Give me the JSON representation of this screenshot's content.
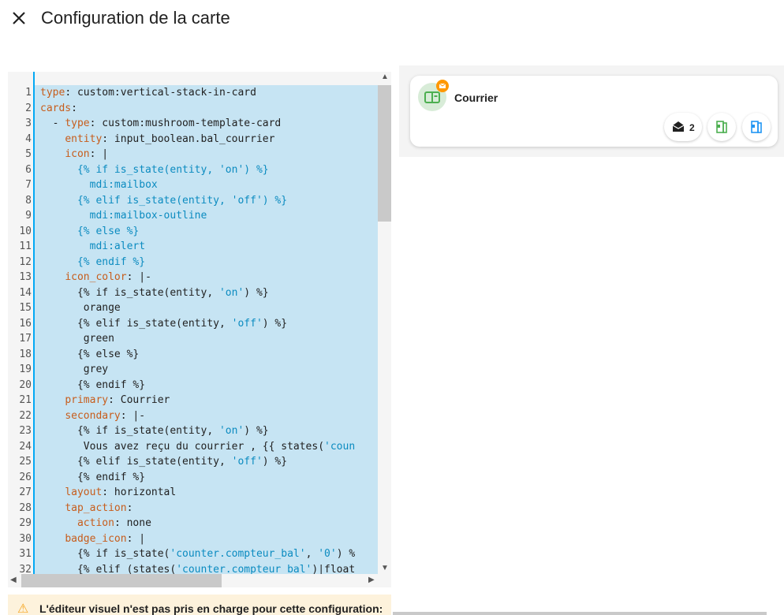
{
  "dialog": {
    "title": "Configuration de la carte"
  },
  "editor": {
    "line_numbers": [
      "1",
      "2",
      "3",
      "4",
      "5",
      "6",
      "7",
      "8",
      "9",
      "10",
      "11",
      "12",
      "13",
      "14",
      "15",
      "16",
      "17",
      "18",
      "19",
      "20",
      "21",
      "22",
      "23",
      "24",
      "25",
      "26",
      "27",
      "28",
      "29",
      "30",
      "31",
      "32"
    ],
    "lines": [
      [
        [
          "k",
          "type"
        ],
        [
          "p",
          ": custom:vertical-stack-in-card"
        ]
      ],
      [
        [
          "k",
          "cards"
        ],
        [
          "p",
          ":"
        ]
      ],
      [
        [
          "p",
          "  - "
        ],
        [
          "k",
          "type"
        ],
        [
          "p",
          ": custom:mushroom-template-card"
        ]
      ],
      [
        [
          "p",
          "    "
        ],
        [
          "k",
          "entity"
        ],
        [
          "p",
          ": input_boolean.bal_courrier"
        ]
      ],
      [
        [
          "p",
          "    "
        ],
        [
          "k",
          "icon"
        ],
        [
          "p",
          ": |"
        ]
      ],
      [
        [
          "p",
          "      "
        ],
        [
          "t",
          "{% if is_state(entity, 'on') %}"
        ]
      ],
      [
        [
          "p",
          "        "
        ],
        [
          "t",
          "mdi:mailbox"
        ]
      ],
      [
        [
          "p",
          "      "
        ],
        [
          "t",
          "{% elif is_state(entity, 'off') %}"
        ]
      ],
      [
        [
          "p",
          "        "
        ],
        [
          "t",
          "mdi:mailbox-outline"
        ]
      ],
      [
        [
          "p",
          "      "
        ],
        [
          "t",
          "{% else %}"
        ]
      ],
      [
        [
          "p",
          "        "
        ],
        [
          "t",
          "mdi:alert"
        ]
      ],
      [
        [
          "p",
          "      "
        ],
        [
          "t",
          "{% endif %}"
        ]
      ],
      [
        [
          "p",
          "    "
        ],
        [
          "k",
          "icon_color"
        ],
        [
          "p",
          ": |-"
        ]
      ],
      [
        [
          "p",
          "      {% if is_state(entity, "
        ],
        [
          "s",
          "'on'"
        ],
        [
          "p",
          ") %}"
        ]
      ],
      [
        [
          "p",
          "       orange"
        ]
      ],
      [
        [
          "p",
          "      {% elif is_state(entity, "
        ],
        [
          "s",
          "'off'"
        ],
        [
          "p",
          ") %}"
        ]
      ],
      [
        [
          "p",
          "       green"
        ]
      ],
      [
        [
          "p",
          "      {% else %}"
        ]
      ],
      [
        [
          "p",
          "       grey"
        ]
      ],
      [
        [
          "p",
          "      {% endif %}"
        ]
      ],
      [
        [
          "p",
          "    "
        ],
        [
          "k",
          "primary"
        ],
        [
          "p",
          ": Courrier"
        ]
      ],
      [
        [
          "p",
          "    "
        ],
        [
          "k",
          "secondary"
        ],
        [
          "p",
          ": |-"
        ]
      ],
      [
        [
          "p",
          "      {% if is_state(entity, "
        ],
        [
          "s",
          "'on'"
        ],
        [
          "p",
          ") %}"
        ]
      ],
      [
        [
          "p",
          "       Vous avez reçu du courrier , {{ states("
        ],
        [
          "s",
          "'coun"
        ]
      ],
      [
        [
          "p",
          "      {% elif is_state(entity, "
        ],
        [
          "s",
          "'off'"
        ],
        [
          "p",
          ") %}"
        ]
      ],
      [
        [
          "p",
          "      {% endif %}"
        ]
      ],
      [
        [
          "p",
          "    "
        ],
        [
          "k",
          "layout"
        ],
        [
          "p",
          ": horizontal"
        ]
      ],
      [
        [
          "p",
          "    "
        ],
        [
          "k",
          "tap_action"
        ],
        [
          "p",
          ":"
        ]
      ],
      [
        [
          "p",
          "      "
        ],
        [
          "k",
          "action"
        ],
        [
          "p",
          ": none"
        ]
      ],
      [
        [
          "p",
          "    "
        ],
        [
          "k",
          "badge_icon"
        ],
        [
          "p",
          ": |"
        ]
      ],
      [
        [
          "p",
          "      {% if is_state("
        ],
        [
          "s",
          "'counter.compteur_bal'"
        ],
        [
          "p",
          ", "
        ],
        [
          "s",
          "'0'"
        ],
        [
          "p",
          ") %"
        ]
      ],
      [
        [
          "p",
          "      {% elif (states("
        ],
        [
          "s",
          "'counter.compteur_bal'"
        ],
        [
          "p",
          ")|float"
        ]
      ]
    ]
  },
  "warning": {
    "icon": "warning-triangle-icon",
    "text": "L'éditeur visuel n'est pas pris en charge pour cette configuration:"
  },
  "preview": {
    "card_name": "Courrier",
    "icon": "mailbox-outline-icon",
    "badge_icon": "email-icon",
    "chips": [
      {
        "icon": "email-open-icon",
        "count": "2"
      },
      {
        "icon": "door-open-green-icon"
      },
      {
        "icon": "door-open-blue-icon"
      }
    ],
    "colors": {
      "icon_bg": "#d8ecd8",
      "icon": "#4caf50",
      "badge": "#ff9800",
      "chip_green": "#4caf50",
      "chip_blue": "#2196f3",
      "selection": "#c6e4f3",
      "key": "#c75d1c",
      "string": "#0b8bc0"
    }
  }
}
